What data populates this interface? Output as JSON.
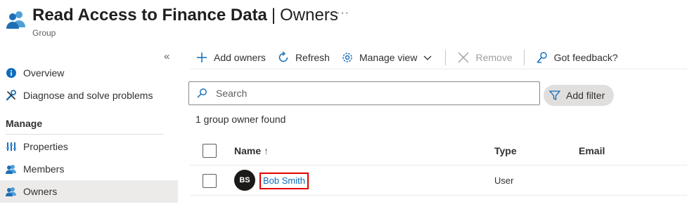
{
  "header": {
    "title": "Read Access to Finance Data",
    "separator": "|",
    "section": "Owners",
    "more": "···",
    "subtitle": "Group",
    "icon": "group-icon"
  },
  "sidebar": {
    "collapse": "«",
    "items": [
      {
        "label": "Overview",
        "icon": "info-icon"
      },
      {
        "label": "Diagnose and solve problems",
        "icon": "wrench-icon"
      }
    ],
    "manage_heading": "Manage",
    "manage_items": [
      {
        "label": "Properties",
        "icon": "properties-icon"
      },
      {
        "label": "Members",
        "icon": "members-icon"
      },
      {
        "label": "Owners",
        "icon": "owners-icon",
        "active": true
      }
    ]
  },
  "toolbar": {
    "add_owners": "Add owners",
    "refresh": "Refresh",
    "manage_view": "Manage view",
    "remove": "Remove",
    "feedback": "Got feedback?"
  },
  "search": {
    "placeholder": "Search",
    "value": ""
  },
  "filter": {
    "label": "Add filter"
  },
  "result_count": "1 group owner found",
  "table": {
    "columns": {
      "name": "Name",
      "sort_arrow": "↑",
      "type": "Type",
      "email": "Email"
    },
    "rows": [
      {
        "initials": "BS",
        "name": "Bob Smith",
        "type": "User",
        "email": ""
      }
    ]
  },
  "colors": {
    "accent": "#0f6cbd",
    "highlight_border": "#e00000",
    "avatar_bg": "#1b1a19",
    "active_nav": "#edebe9"
  }
}
